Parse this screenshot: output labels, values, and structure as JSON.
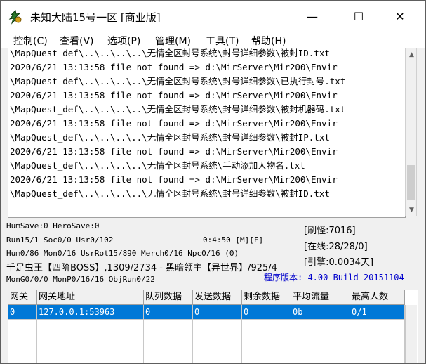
{
  "window": {
    "title": "未知大陆15号一区 [商业版]",
    "minimize_glyph": "—",
    "maximize_glyph": "☐",
    "close_glyph": "✕"
  },
  "menu": {
    "items": [
      "控制(C)",
      "查看(V)",
      "选项(P)",
      "管理(M)",
      "工具(T)",
      "帮助(H)"
    ]
  },
  "log": {
    "lines": [
      "\\MapQuest_def\\..\\..\\..\\..\\无情全区封号系统\\封号详细参数\\被封ID.txt",
      "2020/6/21 13:13:58 file not found => d:\\MirServer\\Mir200\\Envir",
      "\\MapQuest_def\\..\\..\\..\\..\\无情全区封号系统\\封号详细参数\\已执行封号.txt",
      "2020/6/21 13:13:58 file not found => d:\\MirServer\\Mir200\\Envir",
      "\\MapQuest_def\\..\\..\\..\\..\\无情全区封号系统\\封号详细参数\\被封机器码.txt",
      "2020/6/21 13:13:58 file not found => d:\\MirServer\\Mir200\\Envir",
      "\\MapQuest_def\\..\\..\\..\\..\\无情全区封号系统\\封号详细参数\\被封IP.txt",
      "2020/6/21 13:13:58 file not found => d:\\MirServer\\Mir200\\Envir",
      "\\MapQuest_def\\..\\..\\..\\..\\无情全区封号系统\\手动添加人物名.txt",
      "2020/6/21 13:13:58 file not found => d:\\MirServer\\Mir200\\Envir",
      "\\MapQuest_def\\..\\..\\..\\..\\无情全区封号系统\\封号详细参数\\被封ID.txt"
    ]
  },
  "status": {
    "humsave": "HumSave:0 HeroSave:0",
    "run": "Run15/1 Soc0/0 Usr0/102",
    "time": "0:4:50 [M][F]",
    "hum": "Hum0/86 Mon0/16 UsrRot15/890 Merch0/16 Npc0/16 (0)",
    "boss": "千足虫王【四阶BOSS】,1309/2734 - 黑暗领主【异世界】/925/4",
    "mong": "MonG0/0/0 MonP0/16/16 ObjRun0/22",
    "refresh": "[刷怪:7016]",
    "online": "[在线:28/28/0]",
    "engine": "[引擎:0.0034天]",
    "version": "程序版本: 4.00 Build 20151104"
  },
  "grid": {
    "headers": [
      "网关",
      "网关地址",
      "队列数据",
      "发送数据",
      "剩余数据",
      "平均流量",
      "最高人数"
    ],
    "rows": [
      [
        "0",
        "127.0.0.1:53963",
        "0",
        "0",
        "0",
        "0b",
        "0/1"
      ]
    ]
  },
  "colors": {
    "selection": "#0078d7",
    "version_text": "#0000cc"
  }
}
